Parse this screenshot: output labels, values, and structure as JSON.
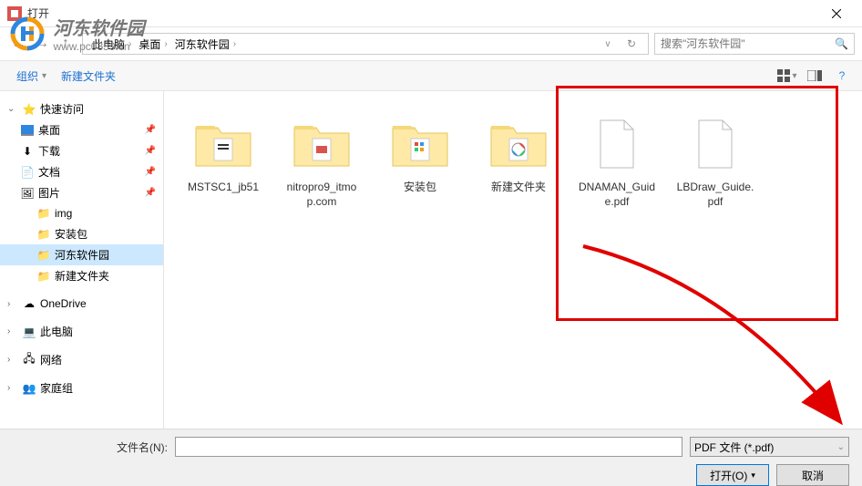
{
  "title": "打开",
  "watermark": {
    "title": "河东软件园",
    "url": "www.pc0359.cn"
  },
  "breadcrumb": {
    "seg1": "此电脑",
    "seg2": "桌面",
    "seg3": "河东软件园"
  },
  "search": {
    "placeholder": "搜索\"河东软件园\""
  },
  "toolbar": {
    "organize": "组织",
    "newfolder": "新建文件夹"
  },
  "sidebar": {
    "quickaccess": "快速访问",
    "desktop": "桌面",
    "downloads": "下载",
    "documents": "文档",
    "pictures": "图片",
    "img": "img",
    "install": "安装包",
    "hedong": "河东软件园",
    "newfolder": "新建文件夹",
    "onedrive": "OneDrive",
    "thispc": "此电脑",
    "network": "网络",
    "homegroup": "家庭组"
  },
  "files": {
    "f1": "MSTSC1_jb51",
    "f2": "nitropro9_itmop.com",
    "f3": "安装包",
    "f4": "新建文件夹",
    "f5": "DNAMAN_Guide.pdf",
    "f6": "LBDraw_Guide.pdf"
  },
  "footer": {
    "filename_label": "文件名(N):",
    "filetype": "PDF 文件 (*.pdf)",
    "open": "打开(O)",
    "cancel": "取消"
  }
}
